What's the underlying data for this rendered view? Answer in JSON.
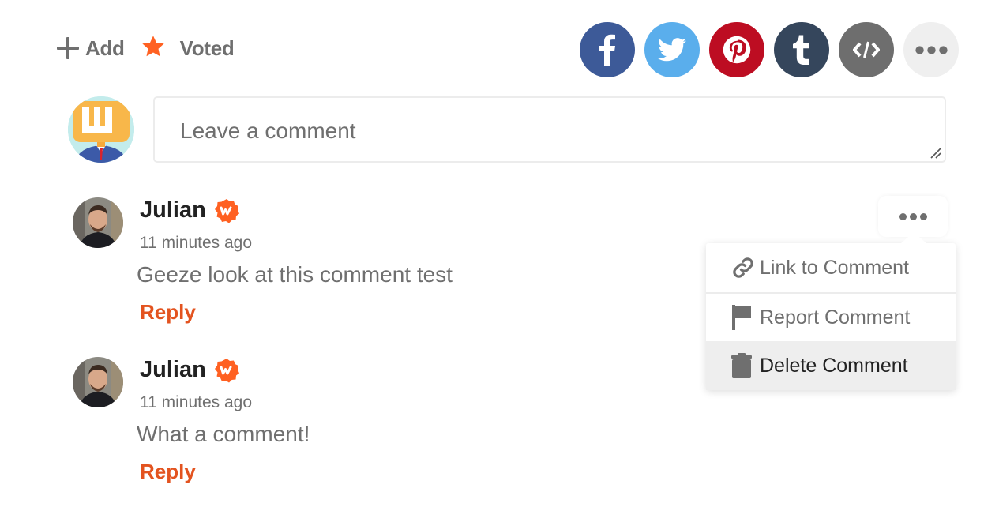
{
  "actions": {
    "add_label": "Add",
    "voted_label": "Voted",
    "icons": {
      "add": "plus-icon",
      "voted": "star-icon"
    }
  },
  "colors": {
    "accent": "#e3531f",
    "star": "#ff6122",
    "text_muted": "#6f6f6f",
    "text_dark": "#222222",
    "facebook": "#3d5a98",
    "twitter": "#5aaeec",
    "pinterest": "#bd0d22",
    "tumblr": "#35465c",
    "embed": "#6e6e6e",
    "more": "#efefef"
  },
  "share": [
    {
      "name": "facebook",
      "icon": "facebook-icon"
    },
    {
      "name": "twitter",
      "icon": "twitter-icon"
    },
    {
      "name": "pinterest",
      "icon": "pinterest-icon"
    },
    {
      "name": "tumblr",
      "icon": "tumblr-icon"
    },
    {
      "name": "embed",
      "icon": "code-icon"
    },
    {
      "name": "more",
      "icon": "more-dots-icon"
    }
  ],
  "composer": {
    "placeholder": "Leave a comment"
  },
  "comments": [
    {
      "author": "Julian",
      "time": "11 minutes ago",
      "text": "Geeze look at this comment test",
      "reply_label": "Reply"
    },
    {
      "author": "Julian",
      "time": "11 minutes ago",
      "text": "What a comment!",
      "reply_label": "Reply"
    }
  ],
  "comment_menu": {
    "items": [
      {
        "label": "Link to Comment",
        "icon": "link-icon"
      },
      {
        "label": "Report Comment",
        "icon": "flag-icon"
      },
      {
        "label": "Delete Comment",
        "icon": "trash-icon",
        "highlighted": true
      }
    ]
  }
}
